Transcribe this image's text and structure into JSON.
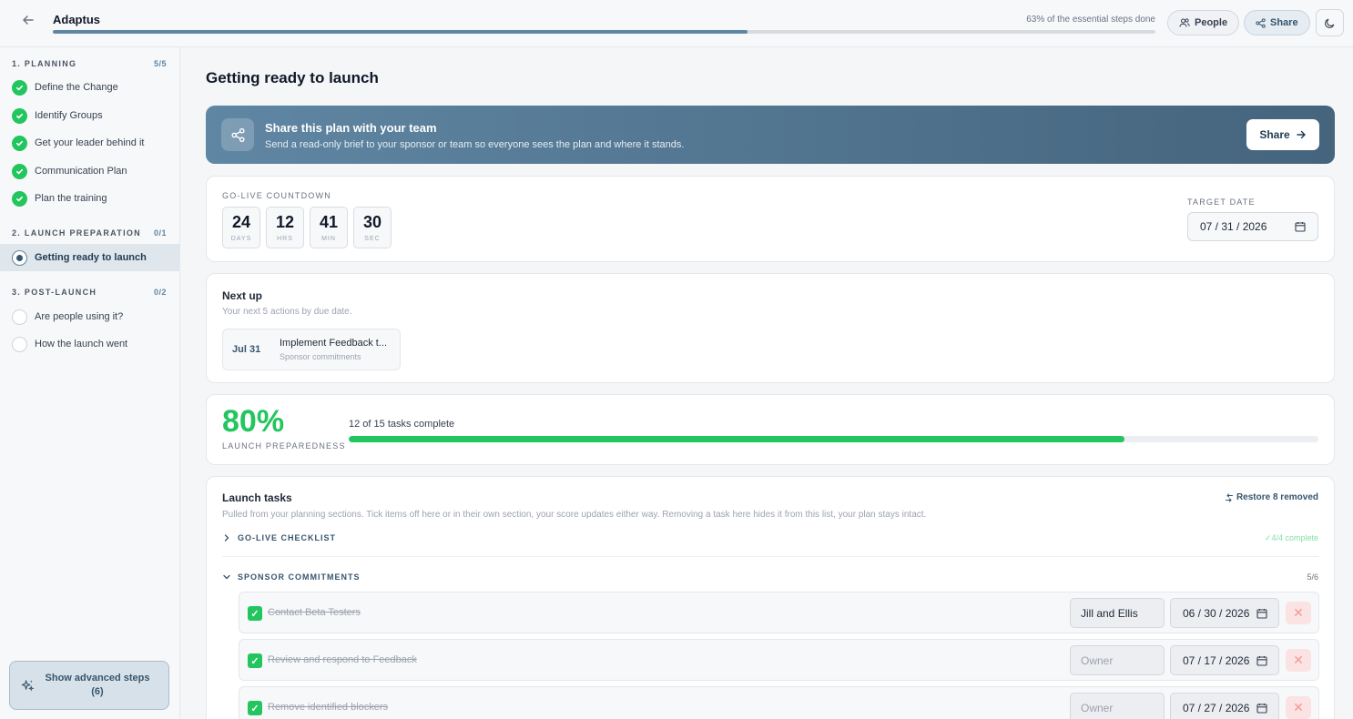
{
  "app": {
    "title": "Adaptus",
    "progress_text": "63% of the essential steps done",
    "progress_fraction": 0.63,
    "people_label": "People",
    "share_label": "Share"
  },
  "sidebar": {
    "sections": [
      {
        "title": "1. PLANNING",
        "count": "5/5"
      },
      {
        "title": "2. LAUNCH PREPARATION",
        "count": "0/1"
      },
      {
        "title": "3. POST-LAUNCH",
        "count": "0/2"
      }
    ],
    "items": [
      {
        "label": "Define the Change",
        "state": "done"
      },
      {
        "label": "Identify Groups",
        "state": "done"
      },
      {
        "label": "Get your leader behind it",
        "state": "done"
      },
      {
        "label": "Communication Plan",
        "state": "done"
      },
      {
        "label": "Plan the training",
        "state": "done"
      },
      {
        "label": "Getting ready to launch",
        "state": "active"
      },
      {
        "label": "Are people using it?",
        "state": "todo"
      },
      {
        "label": "How the launch went",
        "state": "todo"
      }
    ],
    "advanced_label": "Show advanced steps (6)"
  },
  "main": {
    "title": "Getting ready to launch",
    "banner": {
      "title": "Share this plan with your team",
      "subtitle": "Send a read-only brief to your sponsor or team so everyone sees the plan and where it stands.",
      "button": "Share"
    },
    "countdown": {
      "label": "GO-LIVE COUNTDOWN",
      "units": [
        {
          "value": "24",
          "unit": "DAYS"
        },
        {
          "value": "12",
          "unit": "HRS"
        },
        {
          "value": "41",
          "unit": "MIN"
        },
        {
          "value": "30",
          "unit": "SEC"
        }
      ],
      "target_label": "TARGET DATE",
      "target_date": "07 / 31 / 2026"
    },
    "next_up": {
      "title": "Next up",
      "subtitle": "Your next 5 actions by due date.",
      "items": [
        {
          "date": "Jul 31",
          "title": "Implement Feedback t...",
          "section": "Sponsor commitments"
        }
      ]
    },
    "preparedness": {
      "percent": "80%",
      "label": "LAUNCH PREPAREDNESS",
      "tasks_text": "12 of 15 tasks complete",
      "fraction": 0.8
    },
    "launch_tasks": {
      "title": "Launch tasks",
      "restore_label": "Restore 8 removed",
      "subtitle": "Pulled from your planning sections. Tick items off here or in their own section, your score updates either way. Removing a task here hides it from this list, your plan stays intact.",
      "groups": [
        {
          "name": "GO-LIVE CHECKLIST",
          "status": "✓4/4 complete",
          "expanded": false
        },
        {
          "name": "SPONSOR COMMITMENTS",
          "status": "5/6",
          "expanded": true
        }
      ],
      "tasks": [
        {
          "text": "Contact Beta Testers",
          "owner": "Jill and Ellis",
          "owner_placeholder": "Owner",
          "date": "06 / 30 / 2026"
        },
        {
          "text": "Review and respond to Feedback",
          "owner": "",
          "owner_placeholder": "Owner",
          "date": "07 / 17 / 2026"
        },
        {
          "text": "Remove identified blockers",
          "owner": "",
          "owner_placeholder": "Owner",
          "date": "07 / 27 / 2026"
        }
      ]
    }
  },
  "colors": {
    "accent": "#5f86a3",
    "success": "#22c55e",
    "danger": "#f19999"
  }
}
